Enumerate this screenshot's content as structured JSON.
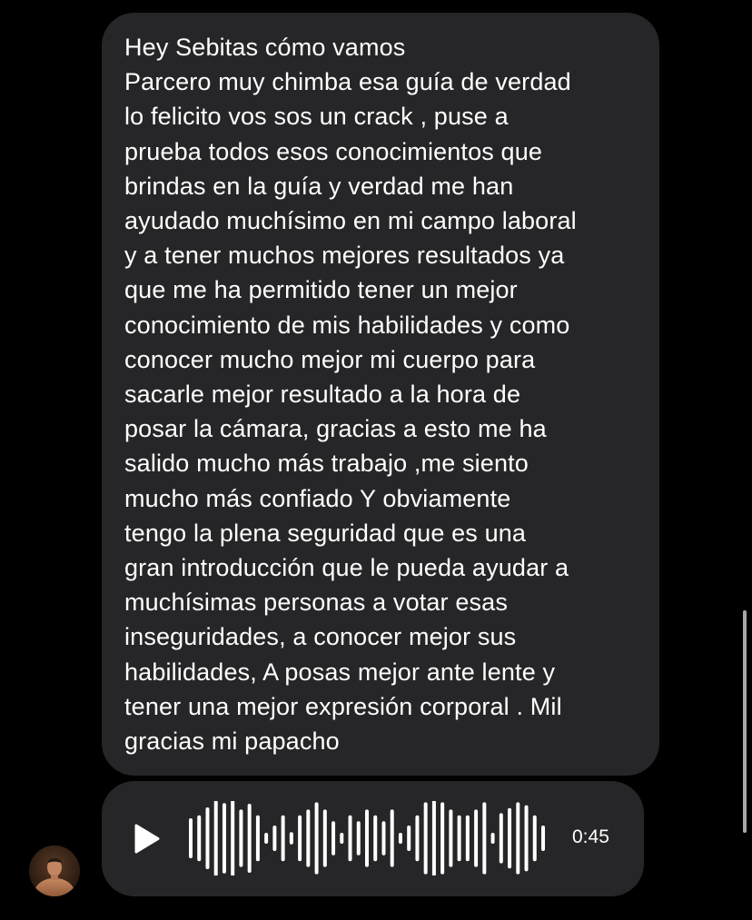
{
  "message": {
    "text": "Hey Sebitas cómo vamos\nParcero muy chimba esa guía de verdad\nlo felicito vos sos un crack , puse a\nprueba todos esos conocimientos que\nbrindas en la guía y verdad me han\nayudado muchísimo en mi campo laboral\ny a tener muchos mejores resultados ya\nque me ha permitido tener un mejor\nconocimiento de mis habilidades y como\nconocer mucho mejor mi cuerpo para\nsacarle mejor resultado a la hora de\nposar la cámara, gracias a esto me ha\nsalido mucho más trabajo ,me siento\nmucho más confiado  Y obviamente\ntengo la plena seguridad  que es una\ngran introducción que le pueda ayudar a\nmuchísimas personas a votar esas\ninseguridades, a conocer mejor sus\nhabilidades, A posas mejor ante lente y\ntener una mejor expresión corporal . Mil\ngracias mi papacho"
  },
  "voice_message": {
    "duration": "0:45",
    "play_icon": "play-icon",
    "waveform_levels": [
      0.5,
      0.58,
      0.8,
      1.0,
      0.92,
      1.0,
      0.74,
      0.9,
      0.58,
      0.1,
      0.3,
      0.58,
      0.12,
      0.58,
      0.74,
      0.94,
      0.74,
      0.42,
      0.1,
      0.58,
      0.42,
      0.74,
      0.58,
      0.42,
      0.74,
      0.1,
      0.3,
      0.58,
      0.94,
      1.0,
      0.94,
      0.74,
      0.58,
      0.58,
      0.74,
      0.94,
      0.1,
      0.64,
      0.78,
      0.94,
      0.86,
      0.58,
      0.3
    ]
  },
  "sender": {
    "avatar_icon": "avatar-photo"
  },
  "colors": {
    "background": "#000000",
    "bubble": "#262628",
    "text": "#ffffff"
  }
}
